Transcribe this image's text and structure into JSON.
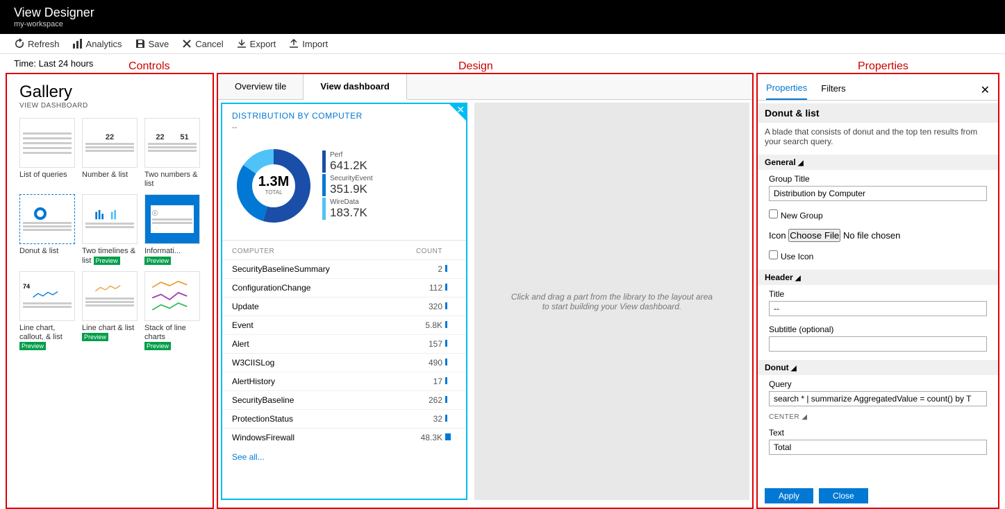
{
  "header": {
    "title": "View Designer",
    "workspace": "my-workspace"
  },
  "toolbar": {
    "refresh": "Refresh",
    "analytics": "Analytics",
    "save": "Save",
    "cancel": "Cancel",
    "export": "Export",
    "import": "Import"
  },
  "time_label": "Time: Last 24 hours",
  "annotations": {
    "controls": "Controls",
    "design": "Design",
    "properties": "Properties"
  },
  "gallery": {
    "title": "Gallery",
    "subtitle": "VIEW DASHBOARD",
    "items": [
      {
        "label": "List of queries"
      },
      {
        "label": "Number & list"
      },
      {
        "label": "Two numbers & list"
      },
      {
        "label": "Donut & list"
      },
      {
        "label": "Two timelines & list",
        "preview": true
      },
      {
        "label": "Informati...",
        "preview": true
      },
      {
        "label": "Line chart, callout, & list",
        "preview": true
      },
      {
        "label": "Line chart & list",
        "preview": true
      },
      {
        "label": "Stack of line charts",
        "preview": true
      }
    ]
  },
  "design_tabs": {
    "overview": "Overview tile",
    "dashboard": "View dashboard"
  },
  "widget": {
    "title": "DISTRIBUTION BY COMPUTER",
    "subtitle": "--",
    "donut": {
      "center_value": "1.3M",
      "center_label": "TOTAL"
    },
    "legend": [
      {
        "label": "Perf",
        "value": "641.2K",
        "color": "#1a4ea8"
      },
      {
        "label": "SecurityEvent",
        "value": "351.9K",
        "color": "#0078d4"
      },
      {
        "label": "WireData",
        "value": "183.7K",
        "color": "#4fc3f7"
      }
    ],
    "list_headers": {
      "c1": "COMPUTER",
      "c2": "COUNT"
    },
    "list": [
      {
        "name": "SecurityBaselineSummary",
        "count": "2"
      },
      {
        "name": "ConfigurationChange",
        "count": "112"
      },
      {
        "name": "Update",
        "count": "320"
      },
      {
        "name": "Event",
        "count": "5.8K"
      },
      {
        "name": "Alert",
        "count": "157"
      },
      {
        "name": "W3CIISLog",
        "count": "490"
      },
      {
        "name": "AlertHistory",
        "count": "17"
      },
      {
        "name": "SecurityBaseline",
        "count": "262"
      },
      {
        "name": "ProtectionStatus",
        "count": "32"
      },
      {
        "name": "WindowsFirewall",
        "count": "48.3K"
      }
    ],
    "see_all": "See all..."
  },
  "drop_hint": "Click and drag a part from the library to the layout area to start building your View dashboard.",
  "props": {
    "tabs": {
      "properties": "Properties",
      "filters": "Filters"
    },
    "title": "Donut & list",
    "desc": "A blade that consists of donut and the top ten results from your search query.",
    "sections": {
      "general": "General",
      "header": "Header",
      "donut": "Donut",
      "center": "CENTER"
    },
    "fields": {
      "group_title_label": "Group Title",
      "group_title_value": "Distribution by Computer",
      "new_group": "New Group",
      "icon_label": "Icon",
      "choose_file": "Choose File",
      "no_file": "No file chosen",
      "use_icon": "Use Icon",
      "title_label": "Title",
      "title_value": "--",
      "subtitle_label": "Subtitle (optional)",
      "subtitle_value": "",
      "query_label": "Query",
      "query_value": "search * | summarize AggregatedValue = count() by T",
      "text_label": "Text",
      "text_value": "Total"
    },
    "buttons": {
      "apply": "Apply",
      "close": "Close"
    }
  }
}
